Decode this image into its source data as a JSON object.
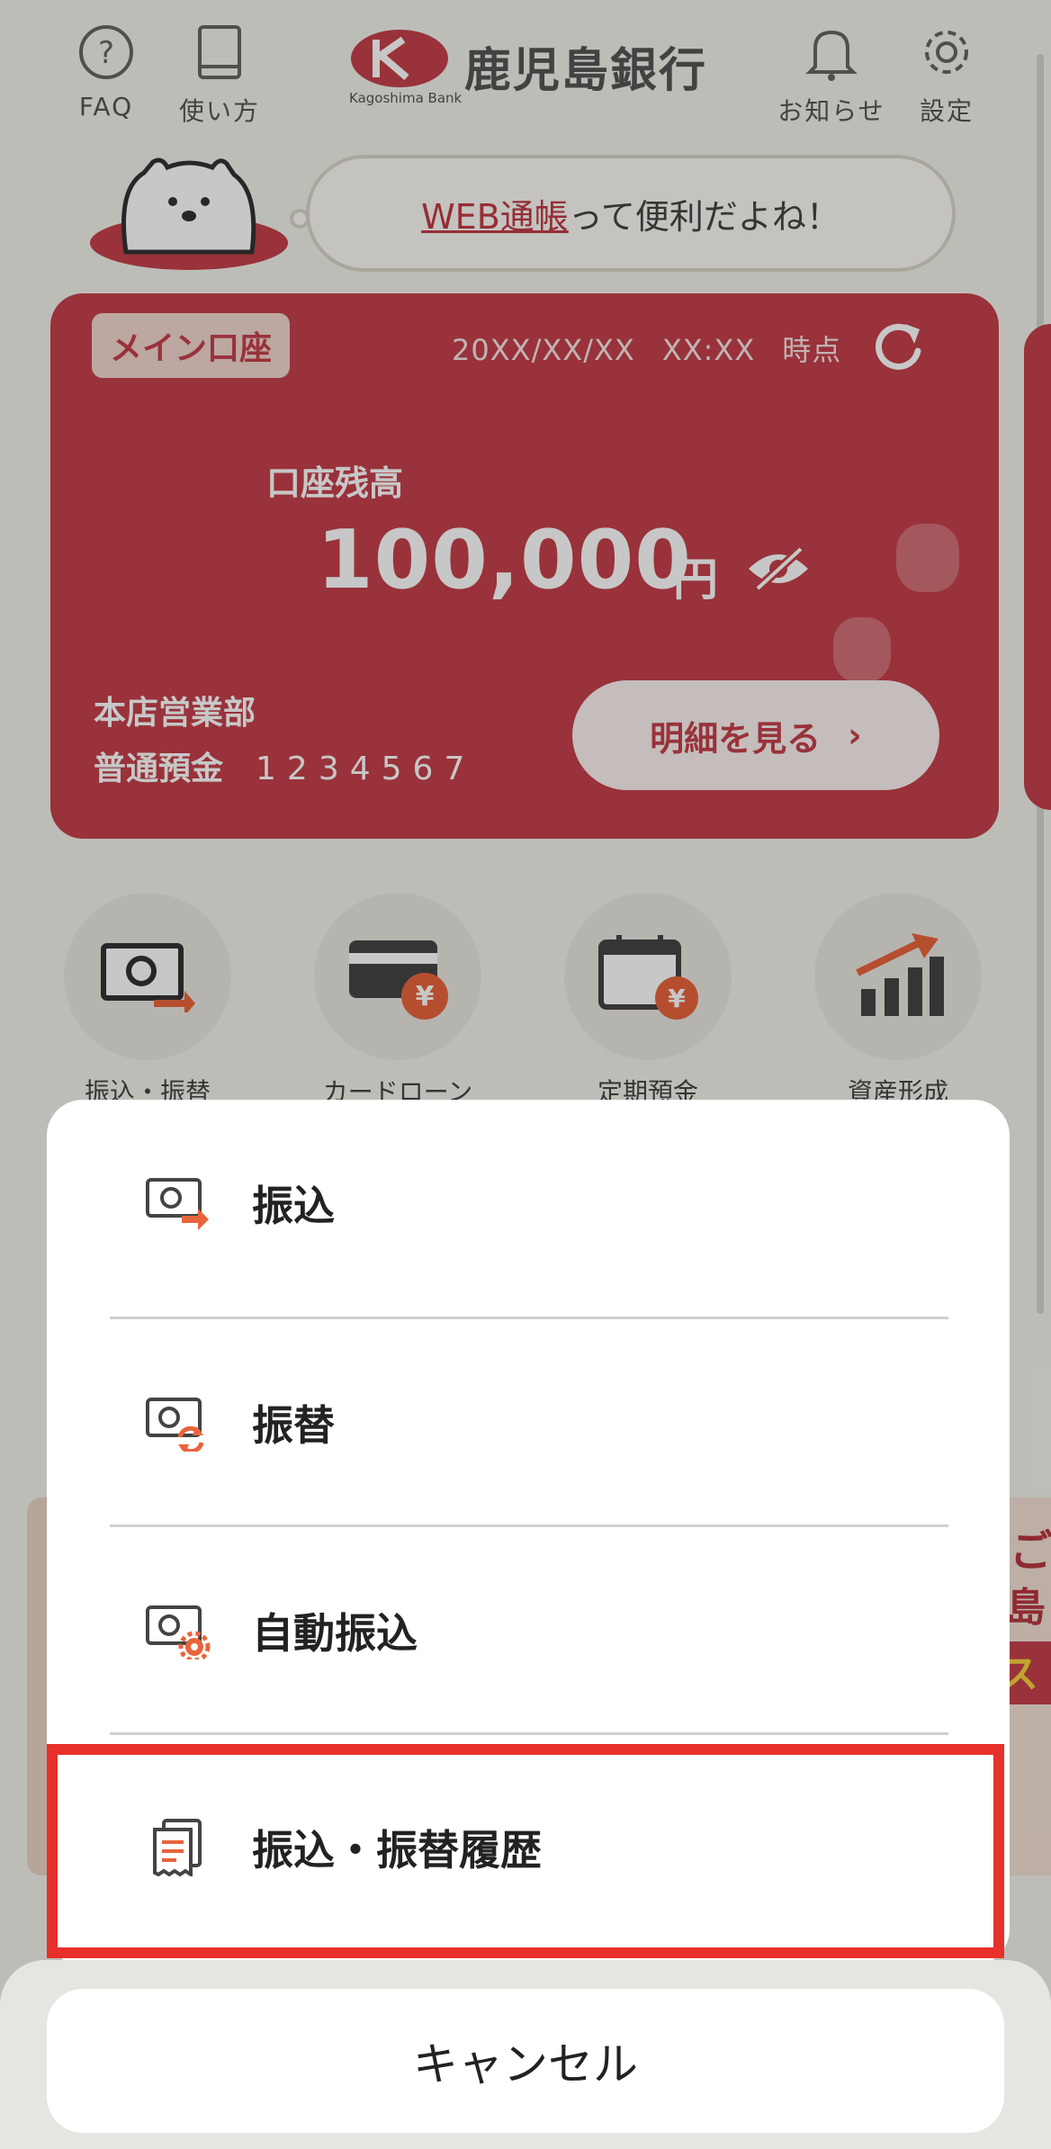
{
  "header": {
    "faq_label": "FAQ",
    "howto_label": "使い方",
    "bank_name": "鹿児島銀行",
    "bank_name_en": "Kagoshima Bank",
    "news_label": "お知らせ",
    "settings_label": "設定"
  },
  "promo": {
    "link_text": "WEB通帳",
    "rest_text": "って便利だよね！"
  },
  "account_card": {
    "tag": "メイン口座",
    "date": "20XX/XX/XX",
    "time": "XX:XX",
    "as_of": "時点",
    "balance_label": "口座残高",
    "balance": "100,000",
    "unit": "円",
    "branch": "本店営業部",
    "account_type": "普通預金",
    "account_number": "1234567",
    "details_button": "明細を見る",
    "details_chevron": "›"
  },
  "quick_menu": [
    {
      "label": "振込・振替",
      "icon": "transfer-icon"
    },
    {
      "label": "カードローン",
      "icon": "card-loan-icon"
    },
    {
      "label": "定期預金",
      "icon": "time-deposit-icon"
    },
    {
      "label": "資産形成",
      "icon": "asset-growth-icon"
    }
  ],
  "banner": {
    "line1": "ご",
    "line2": "島銀",
    "line3": "ス"
  },
  "action_sheet": {
    "options": [
      {
        "label": "振込",
        "icon": "transfer-icon"
      },
      {
        "label": "振替",
        "icon": "account-transfer-icon"
      },
      {
        "label": "自動振込",
        "icon": "auto-transfer-icon"
      },
      {
        "label": "振込・振替履歴",
        "icon": "history-icon"
      }
    ],
    "cancel_label": "キャンセル"
  },
  "colors": {
    "accent": "#c5404b",
    "highlight": "#e8302a",
    "icon_orange": "#e8643c"
  }
}
